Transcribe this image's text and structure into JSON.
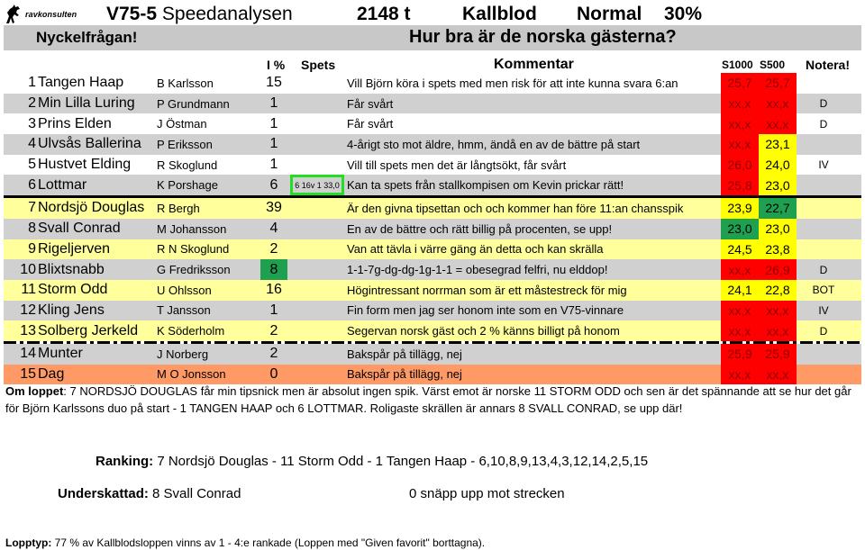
{
  "header": {
    "logo_text": "ravkonsulten",
    "logo_icon": "horse-icon",
    "race": "V75-5",
    "title": "Speedanalysen",
    "distance": "2148 t",
    "breed": "Kallblod",
    "type": "Normal",
    "percent": "30%"
  },
  "key_question": {
    "label": "Nyckelfrågan!",
    "question": "Hur bra är de norska gästerna?"
  },
  "columns": {
    "pct": "I %",
    "spets": "Spets",
    "comment": "Kommentar",
    "s1000": "S1000",
    "s500": "S500",
    "notera": "Notera!"
  },
  "colors": {
    "red": "#ff0000",
    "yellow": "#ffff00",
    "green": "#1fa050",
    "row_grey": "#d0d0d0",
    "row_yellow": "#ffff9c",
    "row_orange": "#ff9966",
    "spets_box": "#22dd22"
  },
  "horses": [
    {
      "num": "1",
      "name": "Tangen Haap",
      "driver": "B Karlsson",
      "pct": "15",
      "spets": "",
      "comment": "Vill Björn köra i spets med men risk för att inte kunna svara 6:an",
      "s1000": "25,7",
      "s1000_c": "red",
      "s500": "25,7",
      "s500_c": "red",
      "notera": "",
      "bg": "white"
    },
    {
      "num": "2",
      "name": "Min Lilla Luring",
      "driver": "P Grundmann",
      "pct": "1",
      "spets": "",
      "comment": "Får svårt",
      "s1000": "xx,x",
      "s1000_c": "red",
      "s500": "xx,x",
      "s500_c": "red",
      "notera": "D",
      "bg": "grey"
    },
    {
      "num": "3",
      "name": "Prins Elden",
      "driver": "J Östman",
      "pct": "1",
      "spets": "",
      "comment": "Får svårt",
      "s1000": "xx,x",
      "s1000_c": "red",
      "s500": "xx,x",
      "s500_c": "red",
      "notera": "D",
      "bg": "white"
    },
    {
      "num": "4",
      "name": "Ulvsås Ballerina",
      "driver": "P Eriksson",
      "pct": "1",
      "spets": "",
      "comment": "4-årigt sto mot äldre, hmm, ändå en av de bättre på start",
      "s1000": "xx,x",
      "s1000_c": "red",
      "s500": "23,1",
      "s500_c": "ylw",
      "notera": "",
      "bg": "grey"
    },
    {
      "num": "5",
      "name": "Hustvet Elding",
      "driver": "R Skoglund",
      "pct": "1",
      "spets": "",
      "comment": "Vill till spets men det är långtsökt, får svårt",
      "s1000": "26,0",
      "s1000_c": "red",
      "s500": "24,0",
      "s500_c": "ylw",
      "notera": "IV",
      "bg": "white"
    },
    {
      "num": "6",
      "name": "Lottmar",
      "driver": "K Porshage",
      "pct": "6",
      "spets": "6 16v 1 33,0",
      "comment": "Kan ta spets från stallkompisen om Kevin prickar rätt!",
      "s1000": "25,8",
      "s1000_c": "red",
      "s500": "23,0",
      "s500_c": "ylw",
      "notera": "",
      "bg": "grey"
    },
    {
      "num": "7",
      "name": "Nordsjö Douglas",
      "driver": "R Bergh",
      "pct": "39",
      "spets": "",
      "comment": "Är den givna tipsettan och och kommer han före 11:an chansspik",
      "s1000": "23,9",
      "s1000_c": "ylw",
      "s500": "22,7",
      "s500_c": "grn",
      "notera": "",
      "bg": "yellow"
    },
    {
      "num": "8",
      "name": "Svall Conrad",
      "driver": "M Johansson",
      "pct": "4",
      "spets": "",
      "comment": "En av de bättre och rätt billig på procenten, se upp!",
      "s1000": "23,0",
      "s1000_c": "grn",
      "s500": "23,0",
      "s500_c": "ylw",
      "notera": "",
      "bg": "grey"
    },
    {
      "num": "9",
      "name": "Rigeljerven",
      "driver": "R N Skoglund",
      "pct": "2",
      "spets": "",
      "comment": "Van att tävla i värre gäng än detta och kan skrälla",
      "s1000": "24,5",
      "s1000_c": "ylw",
      "s500": "23,8",
      "s500_c": "ylw",
      "notera": "",
      "bg": "yellow"
    },
    {
      "num": "10",
      "name": "Blixtsnabb",
      "driver": "G Fredriksson",
      "pct": "8",
      "pct_green": true,
      "spets": "",
      "comment": "1-1-7g-dg-dg-1g-1-1 = obesegrad felfri, nu elddop!",
      "s1000": "xx,x",
      "s1000_c": "red",
      "s500": "26,9",
      "s500_c": "red",
      "notera": "D",
      "bg": "grey"
    },
    {
      "num": "11",
      "name": "Storm Odd",
      "driver": "U Ohlsson",
      "pct": "16",
      "spets": "",
      "comment": "Högintressant norrman som är ett måstestreck för mig",
      "s1000": "24,1",
      "s1000_c": "ylw",
      "s500": "22,8",
      "s500_c": "ylw",
      "notera": "BOT",
      "bg": "yellow"
    },
    {
      "num": "12",
      "name": "Kling Jens",
      "driver": "T Jansson",
      "pct": "1",
      "spets": "",
      "comment": "Fin form men jag ser honom inte som en V75-vinnare",
      "s1000": "xx,x",
      "s1000_c": "red",
      "s500": "xx,x",
      "s500_c": "red",
      "notera": "IV",
      "bg": "grey"
    },
    {
      "num": "13",
      "name": "Solberg Jerkeld",
      "driver": "K Söderholm",
      "pct": "2",
      "spets": "",
      "comment": "Segervan norsk gäst och 2 % känns billigt på honom",
      "s1000": "xx,x",
      "s1000_c": "red",
      "s500": "xx,x",
      "s500_c": "red",
      "notera": "D",
      "bg": "yellow"
    },
    {
      "num": "14",
      "name": "Munter",
      "driver": "J Norberg",
      "pct": "2",
      "spets": "",
      "comment": "Bakspår på tillägg, nej",
      "s1000": "25,9",
      "s1000_c": "red",
      "s500": "25,9",
      "s500_c": "red",
      "notera": "",
      "bg": "grey"
    },
    {
      "num": "15",
      "name": "Dag",
      "driver": "M O Jonsson",
      "pct": "0",
      "spets": "",
      "comment": "Bakspår på tillägg, nej",
      "s1000": "xx,x",
      "s1000_c": "red",
      "s500": "xx,x",
      "s500_c": "red",
      "notera": "",
      "bg": "orange"
    }
  ],
  "om_loppet": {
    "label": "Om loppet",
    "text": ": 7 NORDSJÖ DOUGLAS får min tipsnick men är absolut ingen spik. Värst emot är norske 11 STORM ODD och sen är det spännande att se hur det går för Björn Karlssons duo på start - 1 TANGEN HAAP och 6 LOTTMAR. Roligaste skrällen är annars 8 SVALL CONRAD, se upp där!"
  },
  "ranking": {
    "label": "Ranking:",
    "text": " 7 Nordsjö Douglas - 11 Storm Odd - 1 Tangen Haap - 6,10,8,9,13,4,3,12,14,2,5,15"
  },
  "underskattad": {
    "label": "Underskattad:",
    "text": " 8 Svall Conrad",
    "snapp": "0 snäpp upp mot strecken"
  },
  "lopptyp": {
    "label": "Lopptyp:",
    "text": " 77 % av Kallblodsloppen vinns av 1 - 4:e rankade (Loppen med \"Given favorit\" borttagna)."
  }
}
